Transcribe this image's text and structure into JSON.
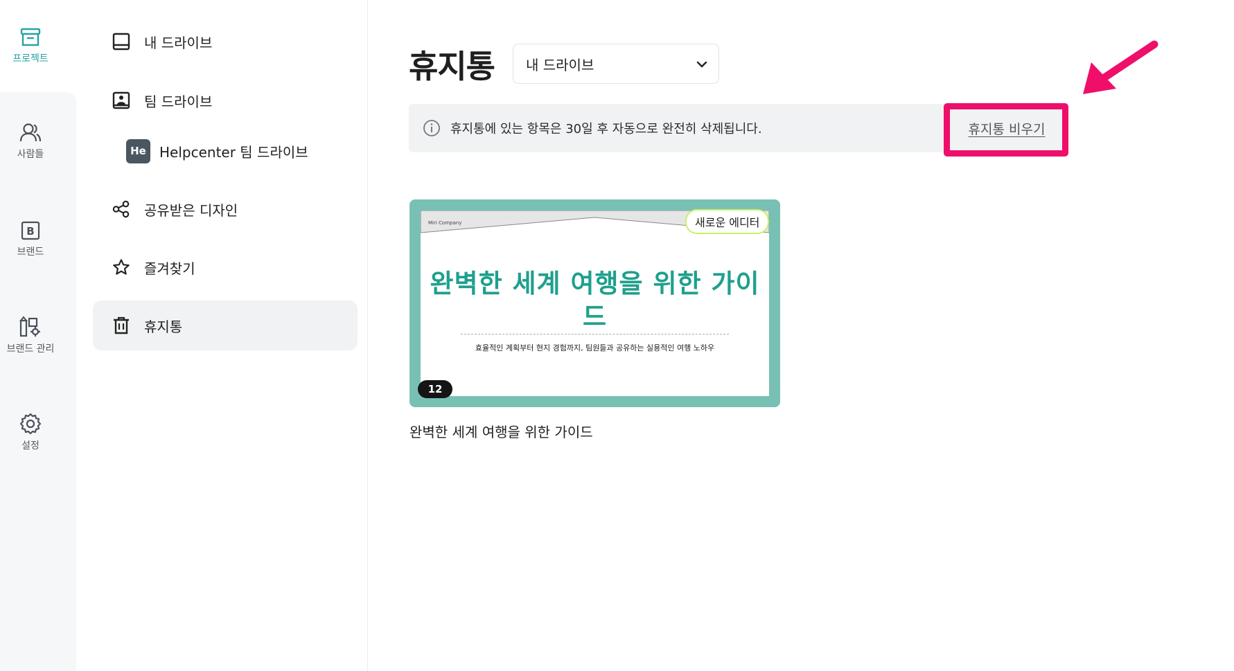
{
  "rail": {
    "items": [
      {
        "label": "프로젝트",
        "icon": "archive-icon",
        "active": true
      },
      {
        "label": "사람들",
        "icon": "people-icon"
      },
      {
        "label": "브랜드",
        "icon": "brand-b-icon"
      },
      {
        "label": "브랜드 관리",
        "icon": "brand-manage-icon"
      },
      {
        "label": "설정",
        "icon": "gear-icon"
      }
    ]
  },
  "nav": {
    "my_drive": "내 드라이브",
    "team_drive": "팀 드라이브",
    "helpcenter_badge": "He",
    "helpcenter_drive": "Helpcenter 팀 드라이브",
    "shared": "공유받은 디자인",
    "favorites": "즐겨찾기",
    "trash": "휴지통"
  },
  "main": {
    "title": "휴지통",
    "drive_select": "내 드라이브",
    "notice": "휴지통에 있는 항목은 30일 후 자동으로 완전히 삭제됩니다.",
    "empty_trash": "휴지통 비우기"
  },
  "card": {
    "company": "Miri Company",
    "slide_title": "완벽한 세계 여행을 위한 가이드",
    "slide_subtitle": "효율적인 계획부터 현지 경험까지, 팀원들과 공유하는 실용적인 여행 노하우",
    "badge": "새로운 에디터",
    "page_count": "12",
    "label": "완벽한 세계 여행을 위한 가이드"
  },
  "colors": {
    "accent": "#2aa1a3",
    "highlight": "#ef0f6a",
    "card_frame": "#79c0b4",
    "slide_title": "#1ea08d"
  }
}
